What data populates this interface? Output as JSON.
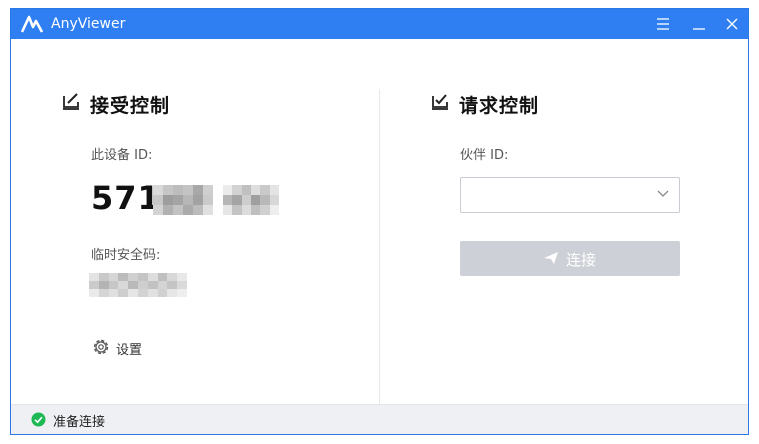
{
  "app": {
    "title": "AnyViewer"
  },
  "left": {
    "title": "接受控制",
    "device_id_label": "此设备 ID:",
    "device_id_prefix": "571",
    "temp_code_label": "临时安全码:",
    "settings_label": "设置"
  },
  "right": {
    "title": "请求控制",
    "partner_label": "伙伴 ID:",
    "partner_value": "",
    "connect_label": "连接"
  },
  "status": {
    "text": "准备连接",
    "color": "#1db954"
  },
  "colors": {
    "titlebar": "#2f7ff2",
    "button_disabled": "#cdd0d6"
  },
  "icons": {
    "logo": "anyviewer-logo-icon",
    "menu": "menu-icon",
    "minimize": "minimize-icon",
    "close": "close-icon",
    "receive": "monitor-edit-icon",
    "request": "monitor-check-icon",
    "settings": "gear-icon",
    "dropdown": "chevron-down-icon",
    "send": "send-icon",
    "status": "check-circle-icon"
  }
}
